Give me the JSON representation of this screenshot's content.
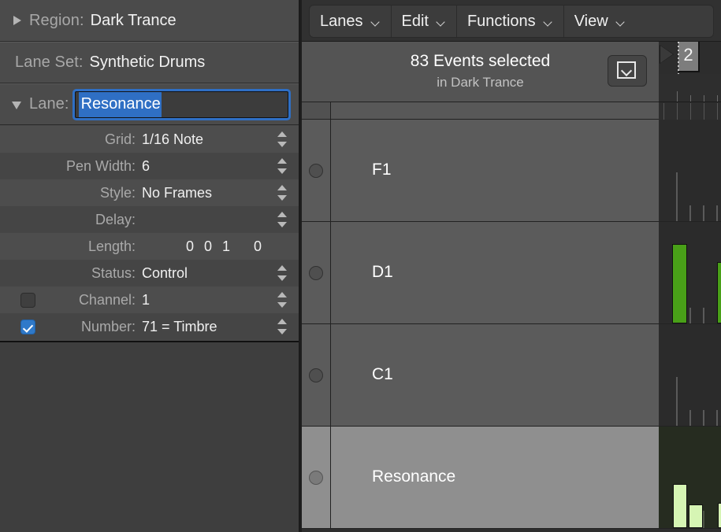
{
  "inspector": {
    "region": {
      "label": "Region:",
      "value": "Dark Trance",
      "disclosure": "triangle-right-icon"
    },
    "lane_set": {
      "label": "Lane Set:",
      "value": "Synthetic Drums"
    },
    "lane": {
      "label": "Lane:",
      "value": "Resonance",
      "disclosure": "triangle-down-icon"
    },
    "params": [
      {
        "label": "Grid:",
        "value": "1/16 Note",
        "stepper": true,
        "checkbox": null
      },
      {
        "label": "Pen Width:",
        "value": "6",
        "stepper": true,
        "checkbox": null
      },
      {
        "label": "Style:",
        "value": "No Frames",
        "stepper": true,
        "checkbox": null
      },
      {
        "label": "Delay:",
        "value": "",
        "stepper": true,
        "checkbox": null
      },
      {
        "label": "Length:",
        "value": "0 0 1",
        "value2": "0",
        "stepper": false,
        "checkbox": null
      },
      {
        "label": "Status:",
        "value": "Control",
        "stepper": true,
        "checkbox": null
      },
      {
        "label": "Channel:",
        "value": "1",
        "stepper": true,
        "checkbox": "off"
      },
      {
        "label": "Number:",
        "value": "71 = Timbre",
        "stepper": true,
        "checkbox": "on"
      }
    ]
  },
  "toolbar": {
    "menus": [
      {
        "label": "Lanes",
        "icon": "chevron-down-icon"
      },
      {
        "label": "Edit",
        "icon": "chevron-down-icon"
      },
      {
        "label": "Functions",
        "icon": "chevron-down-icon"
      },
      {
        "label": "View",
        "icon": "chevron-down-icon"
      }
    ]
  },
  "selection": {
    "main": "83 Events selected",
    "sub": "in Dark Trance",
    "button_icon": "chevron-down-box-icon"
  },
  "ruler": {
    "bar_number": "2",
    "playhead_icon": "playhead-marker-icon"
  },
  "lanes": [
    {
      "name": "F1",
      "selected": false,
      "button_icon": "lane-record-circle-icon"
    },
    {
      "name": "D1",
      "selected": false,
      "button_icon": "lane-record-circle-icon"
    },
    {
      "name": "C1",
      "selected": false,
      "button_icon": "lane-record-circle-icon"
    },
    {
      "name": "Resonance",
      "selected": true,
      "button_icon": "lane-record-circle-icon"
    }
  ],
  "colors": {
    "accent_blue": "#2f6fc4",
    "event_green": "#49a018",
    "event_light_green": "#d6f5b4",
    "panel_bg": "#494949",
    "lane_bg": "#5b5b5b",
    "lane_selected_bg": "#8f8f8f"
  }
}
